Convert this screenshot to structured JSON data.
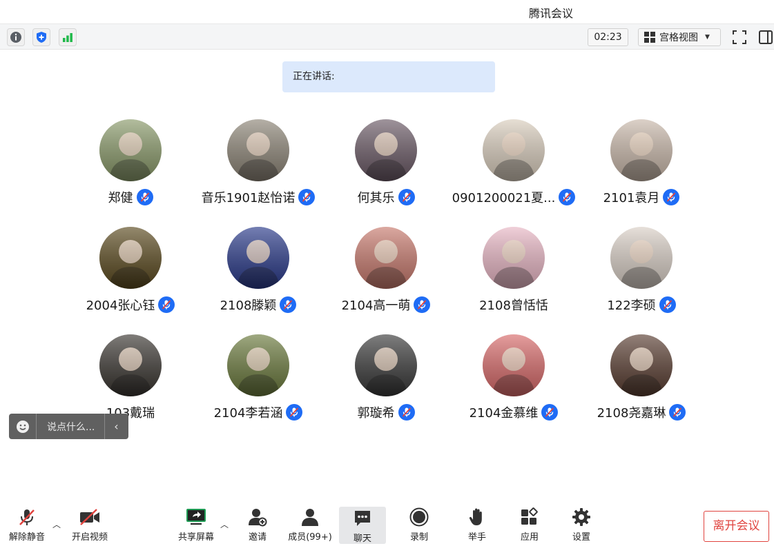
{
  "window": {
    "title": "腾讯会议"
  },
  "toolbar": {
    "icons": [
      "info-icon",
      "shield-icon",
      "signal-icon"
    ],
    "timer": "02:23",
    "view_label": "宫格视图",
    "right_icons": [
      "fullscreen-icon",
      "sidebar-toggle-icon"
    ]
  },
  "speaking": {
    "label": "正在讲话:"
  },
  "participants": [
    {
      "name": "郑健",
      "muted": true,
      "color": "#8a9a6a",
      "avatar": "orchard"
    },
    {
      "name": "音乐1901赵怡诺",
      "muted": true,
      "color": "#8d8577",
      "avatar": "blonde"
    },
    {
      "name": "何其乐",
      "muted": true,
      "color": "#6b5a66",
      "avatar": "girl"
    },
    {
      "name": "0901200021夏...",
      "muted": true,
      "color": "#d9cdbd",
      "avatar": "hat"
    },
    {
      "name": "2101袁月",
      "muted": true,
      "color": "#c9b8aa",
      "avatar": "cat-girl"
    },
    {
      "name": "2004张心钰",
      "muted": true,
      "color": "#5b4a1f",
      "avatar": "dark"
    },
    {
      "name": "2108滕颖",
      "muted": true,
      "color": "#2a3a8a",
      "avatar": "doll"
    },
    {
      "name": "2104高一萌",
      "muted": true,
      "color": "#c87a6e",
      "avatar": "sheep"
    },
    {
      "name": "2108曾恬恬",
      "muted": false,
      "color": "#e8b6c4",
      "avatar": "barbie"
    },
    {
      "name": "122李硕",
      "muted": true,
      "color": "#d9cfc6",
      "avatar": "wall"
    },
    {
      "name": "103戴瑞",
      "muted": false,
      "color": "#3a3631",
      "avatar": "boy"
    },
    {
      "name": "2104李若涵",
      "muted": true,
      "color": "#6b7a3d",
      "avatar": "field"
    },
    {
      "name": "郭璇希",
      "muted": true,
      "color": "#3a3a3a",
      "avatar": "cat"
    },
    {
      "name": "2104金慕维",
      "muted": true,
      "color": "#d86a6a",
      "avatar": "toy"
    },
    {
      "name": "2108尧嘉琳",
      "muted": true,
      "color": "#5a3e32",
      "avatar": "woman"
    }
  ],
  "chat_input": {
    "placeholder": "说点什么..."
  },
  "bottom": {
    "unmute": "解除静音",
    "video": "开启视频",
    "share": "共享屏幕",
    "invite": "邀请",
    "members": "成员(99+)",
    "chat": "聊天",
    "record": "录制",
    "raise": "举手",
    "apps": "应用",
    "settings": "设置",
    "leave": "离开会议"
  },
  "colors": {
    "accent": "#1f6cf5",
    "danger": "#e0433e",
    "speaking_bg": "#dce9fc"
  }
}
